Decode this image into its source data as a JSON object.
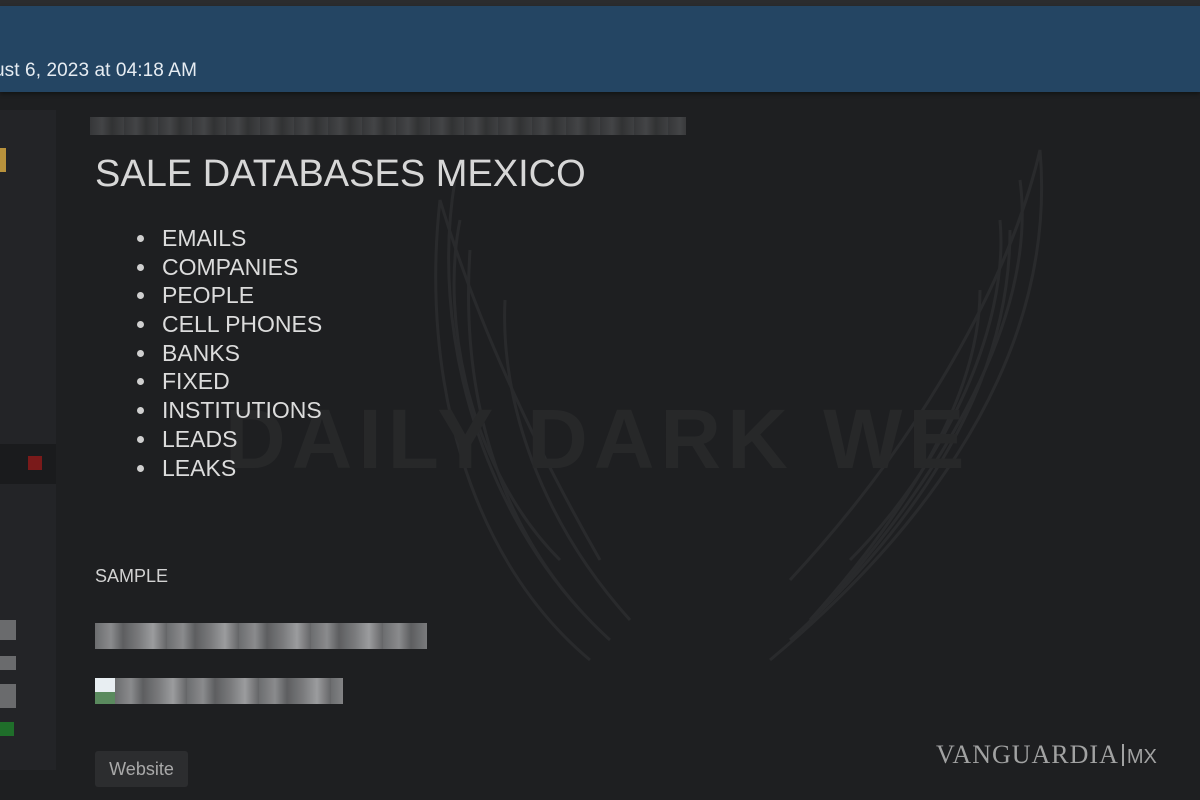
{
  "header": {
    "date_text": "ust 6, 2023 at 04:18 AM",
    "bg_color": "#244563"
  },
  "post": {
    "title": "SALE DATABASES MEXICO",
    "items": [
      "EMAILS",
      "COMPANIES",
      "PEOPLE",
      "CELL PHONES",
      "BANKS",
      "FIXED",
      "INSTITUTIONS",
      "LEADS",
      "LEAKS"
    ],
    "sample_label": "SAMPLE",
    "website_button": "Website"
  },
  "watermark": {
    "text": "DAILY DARK WE",
    "icon": "angel-wings-icon"
  },
  "credit": {
    "brand": "VANGUARDIA",
    "suffix": "MX"
  },
  "colors": {
    "background": "#1e1f21",
    "text": "#d7d7d7",
    "accent_red": "#7a1a1a",
    "accent_gold": "#b8923c",
    "accent_green": "#1f6e2a"
  }
}
